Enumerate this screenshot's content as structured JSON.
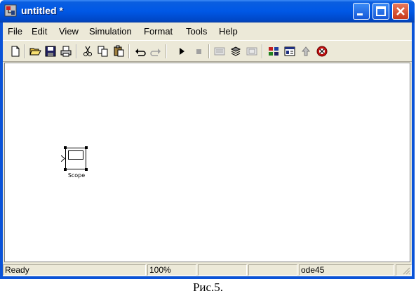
{
  "window": {
    "title": "untitled *"
  },
  "menu": [
    "File",
    "Edit",
    "View",
    "Simulation",
    "Format",
    "Tools",
    "Help"
  ],
  "toolbar": {
    "icons": [
      "new-model-icon",
      "open-icon",
      "save-icon",
      "print-icon",
      "cut-icon",
      "copy-icon",
      "paste-icon",
      "undo-icon",
      "redo-icon",
      "start-simulation-icon",
      "stop-simulation-icon",
      "build-icon",
      "update-diagram-icon",
      "build-subsystem-icon",
      "library-browser-icon",
      "model-explorer-icon",
      "go-to-parent-icon",
      "debugger-icon"
    ]
  },
  "model": {
    "block_label": "Scope"
  },
  "status": {
    "state": "Ready",
    "zoom": "100%",
    "pane3": "",
    "pane4": "",
    "solver": "ode45",
    "pane6": ""
  },
  "caption": "Рис.5.",
  "colors": {
    "title_bar": "#0058e6",
    "close_button": "#c7391a",
    "client_bg": "#ece9d8",
    "canvas_bg": "#ffffff"
  }
}
